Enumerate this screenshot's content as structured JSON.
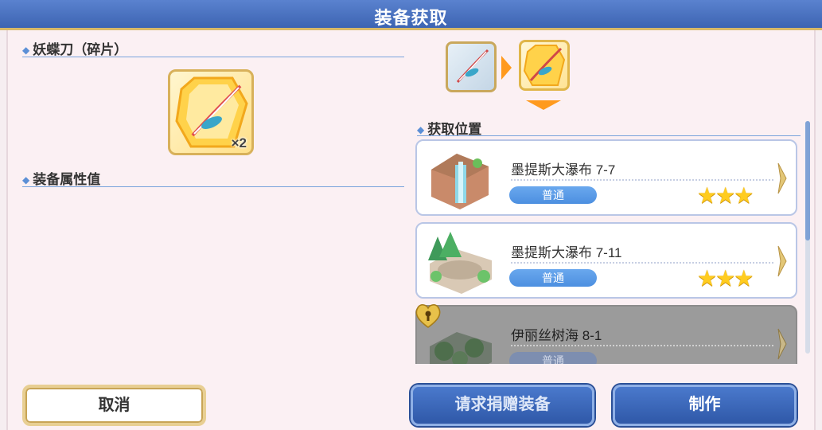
{
  "header": {
    "title": "装备获取"
  },
  "item": {
    "name": "妖蝶刀（碎片）",
    "quantity": "×2"
  },
  "stats": {
    "heading": "装备属性值"
  },
  "sources": {
    "heading": "获取位置",
    "entries": [
      {
        "name": "墨提斯大瀑布 7-7",
        "difficulty": "普通",
        "stars": 3,
        "locked": false
      },
      {
        "name": "墨提斯大瀑布 7-11",
        "difficulty": "普通",
        "stars": 3,
        "locked": false
      },
      {
        "name": "伊丽丝树海 8-1",
        "difficulty": "普通",
        "stars": 0,
        "locked": true
      }
    ]
  },
  "buttons": {
    "cancel": "取消",
    "request": "请求捐赠装备",
    "craft": "制作"
  },
  "colors": {
    "header_blue": "#4a73c2",
    "accent_orange": "#ff9a1e",
    "star_gold": "#ffcc1f",
    "badge_blue": "#4c8fe0"
  },
  "icons": [
    "blade-fragment-icon",
    "blade-icon",
    "arrow-right-icon",
    "arrow-down-icon",
    "waterfall-stage-icon",
    "forest-stage-icon",
    "lock-icon",
    "chevron-right-icon",
    "star-icon"
  ]
}
